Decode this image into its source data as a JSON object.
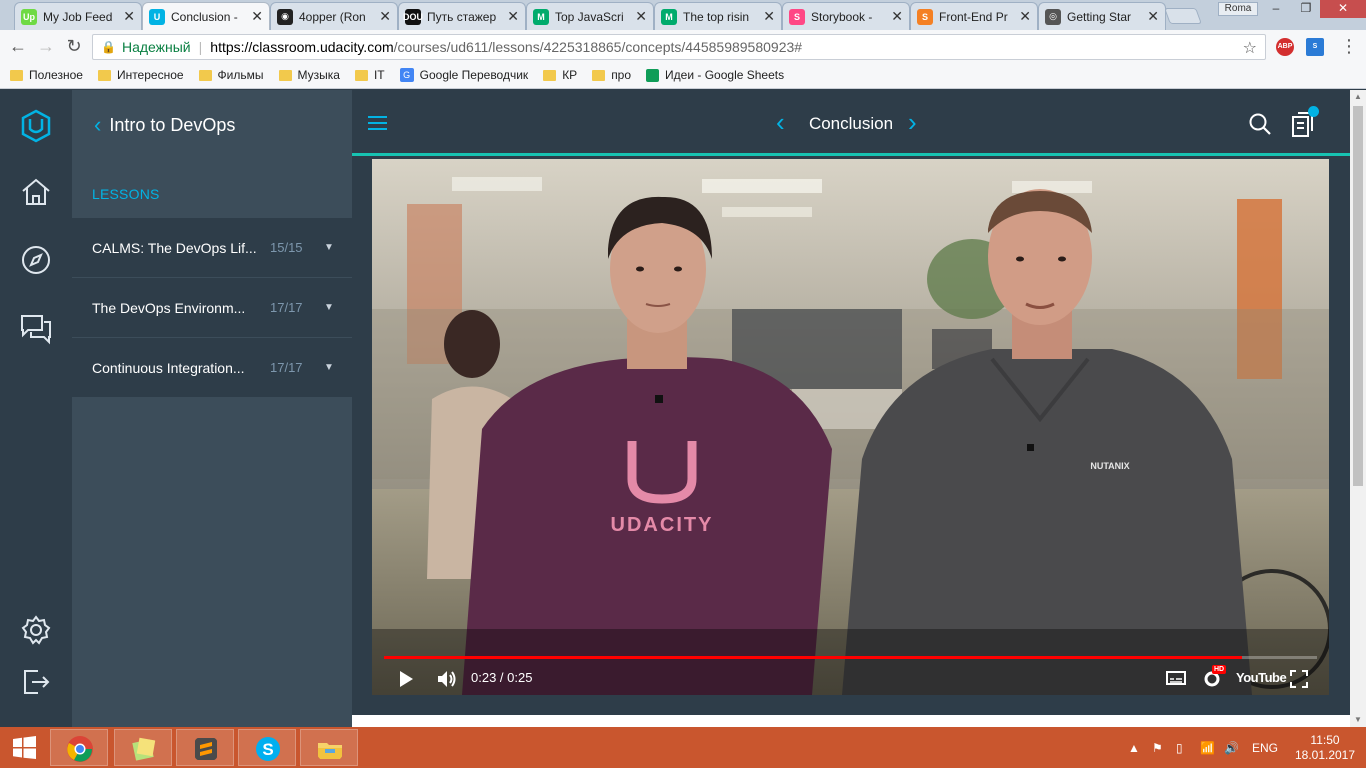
{
  "browser": {
    "tabs": [
      {
        "title": "My Job Feed",
        "favicon": "upwork",
        "color": "#6fda44",
        "text": "Up"
      },
      {
        "title": "Conclusion -",
        "favicon": "udacity",
        "color": "#02b3e4",
        "text": "U",
        "active": true
      },
      {
        "title": "4opper (Ron",
        "favicon": "github",
        "color": "#222222",
        "text": "◉"
      },
      {
        "title": "Путь стажер",
        "favicon": "dou",
        "color": "#111111",
        "text": "DOU"
      },
      {
        "title": "Top JavaScri",
        "favicon": "medium",
        "color": "#00ab6c",
        "text": "M"
      },
      {
        "title": "The top risin",
        "favicon": "medium",
        "color": "#00ab6c",
        "text": "M"
      },
      {
        "title": "Storybook -",
        "favicon": "storybook",
        "color": "#ff4785",
        "text": "S"
      },
      {
        "title": "Front-End Pr",
        "favicon": "stackoverflow",
        "color": "#f48024",
        "text": "S"
      },
      {
        "title": "Getting Star",
        "favicon": "github",
        "color": "#555555",
        "text": "◎"
      }
    ],
    "user_chip": "Roma",
    "window_controls": {
      "minimize": "–",
      "maximize": "❐",
      "close": "✕"
    },
    "address": {
      "secure_label": "Надежный",
      "url_host": "https://classroom.udacity.com",
      "url_path": "/courses/ud611/lessons/4225318865/concepts/44585989580923#"
    },
    "extensions": {
      "abp": "ABP"
    },
    "bookmarks": [
      {
        "label": "Полезное",
        "icon": "folder"
      },
      {
        "label": "Интересное",
        "icon": "folder"
      },
      {
        "label": "Фильмы",
        "icon": "folder"
      },
      {
        "label": "Музыка",
        "icon": "folder"
      },
      {
        "label": "IT",
        "icon": "folder"
      },
      {
        "label": "Google Переводчик",
        "icon": "google-translate"
      },
      {
        "label": "КР",
        "icon": "folder"
      },
      {
        "label": "про",
        "icon": "folder"
      },
      {
        "label": "Идеи - Google Sheets",
        "icon": "sheets"
      }
    ]
  },
  "sidebar": {
    "course_title": "Intro to DevOps",
    "lessons_label": "LESSONS",
    "lessons": [
      {
        "name": "CALMS: The DevOps Lif...",
        "count": "15/15"
      },
      {
        "name": "The DevOps Environm...",
        "count": "17/17"
      },
      {
        "name": "Continuous Integration...",
        "count": "17/17"
      }
    ]
  },
  "header": {
    "title": "Conclusion"
  },
  "video": {
    "time": "0:23 / 0:25",
    "progress": 0.92,
    "shirt_brand": "UDACITY",
    "shirt2_brand": "NUTANIX",
    "hd_badge": "HD",
    "youtube_label": "YouTube"
  },
  "taskbar": {
    "language": "ENG",
    "time": "11:50",
    "date": "18.01.2017"
  },
  "colors": {
    "accent": "#02b3e4",
    "sidebar_bg": "#3c4d5a",
    "rail_bg": "#2e3d49",
    "progress": "#ff0000",
    "taskbar": "#c9562e"
  }
}
